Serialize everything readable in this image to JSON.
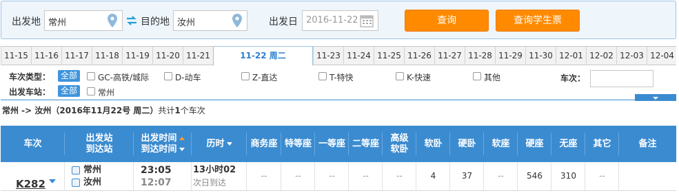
{
  "search": {
    "from_label": "出发地",
    "from_value": "常州",
    "to_label": "目的地",
    "to_value": "汝州",
    "date_label": "出发日",
    "date_value": "2016-11-22",
    "query_button": "查询",
    "student_button": "查询学生票",
    "accent": "#ff8a00"
  },
  "date_tabs": [
    "11-15",
    "11-16",
    "11-17",
    "11-18",
    "11-19",
    "11-20",
    "11-21",
    "11-22 周二",
    "11-23",
    "11-24",
    "11-25",
    "11-26",
    "11-27",
    "11-28",
    "11-29",
    "11-30",
    "12-01",
    "12-02",
    "12-03",
    "12-04"
  ],
  "active_date_index": 7,
  "filters": {
    "train_type_label": "车次类型：",
    "station_label": "出发车站：",
    "all_label": "全部",
    "train_types": [
      "GC-高铁/城际",
      "D-动车",
      "Z-直达",
      "T-特快",
      "K-快速",
      "其他"
    ],
    "stations": [
      "常州"
    ],
    "train_no_label": "车次："
  },
  "summary": {
    "route": "常州 -> 汝州（2016年11月22号  周二）",
    "prefix": "共计",
    "count": "1",
    "suffix": "个车次"
  },
  "table": {
    "headers": {
      "train": "车次",
      "station_1": "出发站",
      "station_2": "到达站",
      "time_1": "出发时间",
      "time_2": "到达时间",
      "duration": "历时",
      "business": "商务座",
      "special": "特等座",
      "first": "一等座",
      "second": "二等座",
      "premium_1": "高级",
      "premium_2": "软卧",
      "soft_sleeper": "软卧",
      "hard_sleeper": "硬卧",
      "soft_seat": "软座",
      "hard_seat": "硬座",
      "no_seat": "无座",
      "other": "其它",
      "remark": "备注"
    },
    "rows": [
      {
        "train_no": "K282",
        "from_station": "常州",
        "to_station": "汝州",
        "depart_time": "23:05",
        "arrive_time": "12:07",
        "duration": "13小时02",
        "arrive_note": "次日到达",
        "business": "--",
        "special": "--",
        "first": "--",
        "second": "--",
        "premium": "--",
        "soft_sleeper": "4",
        "hard_sleeper": "37",
        "soft_seat": "--",
        "hard_seat": "546",
        "no_seat": "310",
        "other": "--",
        "remark": ""
      }
    ]
  },
  "colors": {
    "header_blue": "#3b8bd0",
    "orange": "#ff8a00",
    "arrive_time_gray": "#888888",
    "depart_time": "#333333"
  },
  "icons": {
    "location_pin": "location-pin-icon",
    "swap": "swap-arrows-icon",
    "calendar": "calendar-icon",
    "station": "station-icon",
    "dropdown": "chevron-down-icon"
  }
}
